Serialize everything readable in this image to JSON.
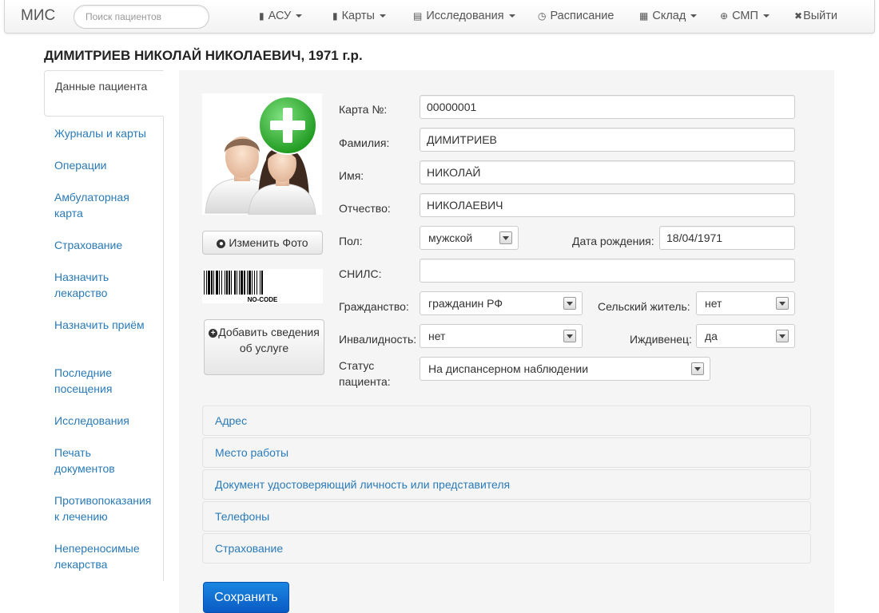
{
  "navbar": {
    "brand": "МИС",
    "search_placeholder": "Поиск пациентов",
    "items": [
      {
        "label": "АСУ",
        "icon": "briefcase-icon"
      },
      {
        "label": "Карты",
        "icon": "book-icon"
      },
      {
        "label": "Исследования",
        "icon": "list-icon"
      },
      {
        "label": "Расписание",
        "icon": "clock-icon"
      },
      {
        "label": "Склад",
        "icon": "calendar-icon"
      },
      {
        "label": "СМП",
        "icon": "plus-circle-icon"
      },
      {
        "label": "Выйти",
        "icon": "close-icon"
      }
    ]
  },
  "patient_title": "ДИМИТРИЕВ НИКОЛАЙ НИКОЛАЕВИЧ, 1971 г.р.",
  "sidebar": {
    "items": [
      {
        "label": "Данные пациента"
      },
      {
        "label": "Журналы и карты"
      },
      {
        "label": "Операции"
      },
      {
        "label": "Амбулаторная карта"
      },
      {
        "label": "Страхование"
      },
      {
        "label": "Назначить лекарство"
      },
      {
        "label": "Назначить приём"
      },
      {
        "label": "Последние посещения"
      },
      {
        "label": "Исследования"
      },
      {
        "label": "Печать документов"
      },
      {
        "label": "Противопоказания к лечению"
      },
      {
        "label": "Непереносимые лекарства"
      }
    ]
  },
  "photo_panel": {
    "change_photo_label": "Изменить Фото",
    "barcode_text": "NO-CODE",
    "add_service_label": "Добавить сведения об услуге"
  },
  "form": {
    "card_no": {
      "label": "Карта №:",
      "value": "00000001"
    },
    "last_name": {
      "label": "Фамилия:",
      "value": "ДИМИТРИЕВ"
    },
    "first_name": {
      "label": "Имя:",
      "value": "НИКОЛАЙ"
    },
    "patronymic": {
      "label": "Отчество:",
      "value": "НИКОЛАЕВИЧ"
    },
    "sex": {
      "label": "Пол:",
      "value": "мужской"
    },
    "birth_date": {
      "label": "Дата рождения:",
      "value": "18/04/1971"
    },
    "snils": {
      "label": "СНИЛС:",
      "value": ""
    },
    "citizenship": {
      "label": "Гражданство:",
      "value": "гражданин РФ"
    },
    "rural": {
      "label": "Сельский житель:",
      "value": "нет"
    },
    "disability": {
      "label": "Инвалидность:",
      "value": "нет"
    },
    "dependent": {
      "label": "Иждивенец:",
      "value": "да"
    },
    "status": {
      "label": "Статус пациента:",
      "value": "На диспансерном наблюдении"
    }
  },
  "accordion": [
    {
      "label": "Адрес"
    },
    {
      "label": "Место работы"
    },
    {
      "label": "Документ удостоверяющий личность или представителя"
    },
    {
      "label": "Телефоны"
    },
    {
      "label": "Страхование"
    }
  ],
  "save_label": "Сохранить",
  "colors": {
    "link": "#2a7ab9",
    "panel_bg": "#f5f5f5",
    "save_button": "#0a5bc4",
    "photo_plus_badge": "#2db52d"
  }
}
